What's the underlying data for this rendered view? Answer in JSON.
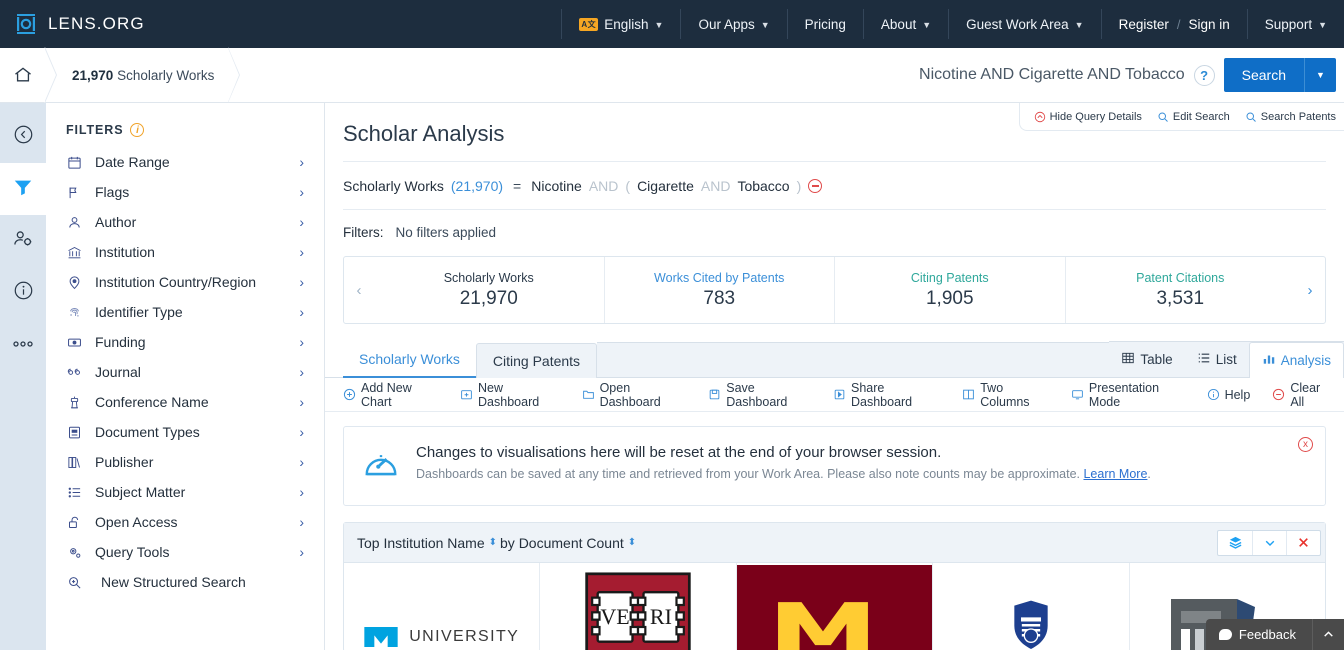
{
  "topnav": {
    "brand": "LENS.ORG",
    "language": {
      "label": "English",
      "badge": "A文"
    },
    "items": [
      {
        "label": "Our Apps",
        "caret": true
      },
      {
        "label": "Pricing",
        "caret": false
      },
      {
        "label": "About",
        "caret": true
      },
      {
        "label": "Guest Work Area",
        "caret": true
      }
    ],
    "register": "Register",
    "separator": "/",
    "signin": "Sign in",
    "support": "Support"
  },
  "crumbbar": {
    "count": "21,970",
    "label": "Scholarly Works",
    "search_value": "Nicotine AND Cigarette AND Tobacco",
    "help": "?",
    "search_button": "Search"
  },
  "rail": {
    "items": [
      {
        "name": "collapse",
        "icon": "chevron-left-circle-icon"
      },
      {
        "name": "filters",
        "icon": "funnel-icon",
        "active": true
      },
      {
        "name": "profile-settings",
        "icon": "user-gear-icon"
      },
      {
        "name": "info",
        "icon": "info-circle-icon"
      },
      {
        "name": "more",
        "icon": "ellipsis-icon"
      }
    ]
  },
  "sidebar": {
    "title": "FILTERS",
    "items": [
      {
        "label": "Date Range",
        "icon": "calendar-icon",
        "arrow": true
      },
      {
        "label": "Flags",
        "icon": "flag-icon",
        "arrow": true
      },
      {
        "label": "Author",
        "icon": "user-icon",
        "arrow": true
      },
      {
        "label": "Institution",
        "icon": "bank-icon",
        "arrow": true
      },
      {
        "label": "Institution Country/Region",
        "icon": "map-pin-icon",
        "arrow": true
      },
      {
        "label": "Identifier Type",
        "icon": "fingerprint-icon",
        "arrow": true
      },
      {
        "label": "Funding",
        "icon": "banknote-icon",
        "arrow": true
      },
      {
        "label": "Journal",
        "icon": "quote-icon",
        "arrow": true
      },
      {
        "label": "Conference Name",
        "icon": "podium-icon",
        "arrow": true
      },
      {
        "label": "Document Types",
        "icon": "document-icon",
        "arrow": true
      },
      {
        "label": "Publisher",
        "icon": "books-icon",
        "arrow": true
      },
      {
        "label": "Subject Matter",
        "icon": "list-icon",
        "arrow": true
      },
      {
        "label": "Open Access",
        "icon": "unlock-icon",
        "arrow": true
      },
      {
        "label": "Query Tools",
        "icon": "gears-icon",
        "arrow": true
      },
      {
        "label": "New Structured Search",
        "icon": "search-plus-icon",
        "arrow": false
      }
    ]
  },
  "query_details": {
    "hide": "Hide Query Details",
    "edit": "Edit Search",
    "search_patents": "Search Patents"
  },
  "main": {
    "page_title": "Scholar Analysis",
    "query": {
      "label": "Scholarly Works",
      "count": "(21,970)",
      "equals": "=",
      "term1": "Nicotine",
      "op1": "AND",
      "paren_open": "(",
      "term2": "Cigarette",
      "op2": "AND",
      "term3": "Tobacco",
      "paren_close": ")"
    },
    "filters_line": {
      "label": "Filters:",
      "value": "No filters applied"
    },
    "stats": [
      {
        "label": "Scholarly Works",
        "value": "21,970",
        "color": "#2b3a4a"
      },
      {
        "label": "Works Cited by Patents",
        "value": "783",
        "color": "#3b8fd8"
      },
      {
        "label": "Citing Patents",
        "value": "1,905",
        "color": "#2fa89b"
      },
      {
        "label": "Patent Citations",
        "value": "3,531",
        "color": "#2fa89b"
      }
    ],
    "tabs": [
      {
        "label": "Scholarly Works",
        "active": true
      },
      {
        "label": "Citing Patents",
        "active": false
      }
    ],
    "view_tabs": [
      {
        "label": "Table",
        "icon": "table-icon",
        "active": false
      },
      {
        "label": "List",
        "icon": "list-icon",
        "active": false
      },
      {
        "label": "Analysis",
        "icon": "bar-chart-icon",
        "active": true
      }
    ],
    "toolbar": [
      {
        "label": "Add New Chart",
        "icon": "plus-circle-icon"
      },
      {
        "label": "New Dashboard",
        "icon": "new-dashboard-icon"
      },
      {
        "label": "Open Dashboard",
        "icon": "folder-open-icon"
      },
      {
        "label": "Save Dashboard",
        "icon": "save-icon"
      },
      {
        "label": "Share Dashboard",
        "icon": "share-icon"
      },
      {
        "label": "Two Columns",
        "icon": "columns-icon"
      },
      {
        "label": "Presentation Mode",
        "icon": "monitor-icon"
      },
      {
        "label": "Help",
        "icon": "info-circle-icon"
      },
      {
        "label": "Clear All",
        "icon": "minus-circle-icon"
      }
    ],
    "notice": {
      "title": "Changes to visualisations here will be reset at the end of your browser session.",
      "sub_before": "Dashboards can be saved at any time and retrieved from your Work Area. Please also note counts may be approximate. ",
      "link": "Learn More",
      "sub_after": ".",
      "icon": "gauge-icon",
      "close": "x"
    },
    "panel": {
      "title_a": "Top Institution Name",
      "title_b": "by Document Count",
      "sort_glyph": "⬍",
      "actions": [
        {
          "name": "layers",
          "glyph": "≋",
          "color": "blue"
        },
        {
          "name": "collapse",
          "glyph": "∨",
          "color": "blue"
        },
        {
          "name": "close",
          "glyph": "✕",
          "color": "red"
        }
      ],
      "logos": [
        {
          "name": "university-of-michigan",
          "text": "UNIVERSITY"
        },
        {
          "name": "harvard-university",
          "text_left": "VE",
          "text_right": "RI"
        },
        {
          "name": "university-of-minnesota",
          "text": "M"
        },
        {
          "name": "shield-university",
          "text": ""
        },
        {
          "name": "partial-logo",
          "text": ""
        }
      ]
    }
  },
  "feedback": {
    "label": "Feedback",
    "up": "⌃"
  }
}
